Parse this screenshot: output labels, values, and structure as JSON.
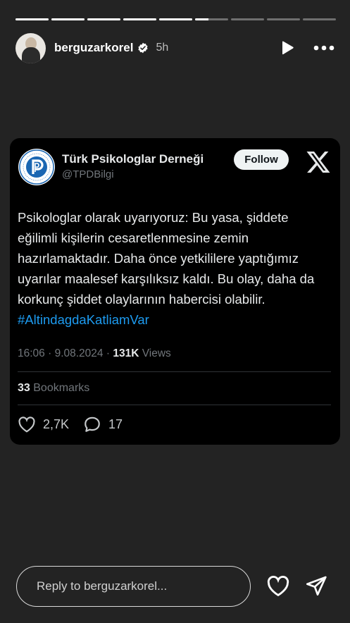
{
  "story": {
    "progress_segments": [
      1,
      1,
      1,
      1,
      1,
      0.4,
      0,
      0,
      0
    ]
  },
  "header": {
    "username": "berguzarkorel",
    "time": "5h",
    "verified": true
  },
  "tweet": {
    "author_name": "Türk Psikologlar Derneği",
    "author_handle": "@TPDBilgi",
    "follow_label": "Follow",
    "body_text": "Psikologlar olarak uyarıyoruz: Bu yasa, şiddete eğilimli kişilerin cesaretlenmesine zemin hazırlamaktadır. Daha önce yetkililere yaptığımız uyarılar maalesef karşılıksız kaldı. Bu olay, daha da korkunç şiddet olaylarının habercisi olabilir.",
    "hashtag": "#AltindagdaKatliamVar",
    "time": "16:06",
    "date": "9.08.2024",
    "views_count": "131K",
    "views_label": "Views",
    "bookmarks_count": "33",
    "bookmarks_label": "Bookmarks",
    "likes": "2,7K",
    "replies": "17"
  },
  "footer": {
    "reply_placeholder": "Reply to berguzarkorel..."
  },
  "colors": {
    "background": "#232323",
    "card": "#000000",
    "link": "#1d9bf0",
    "muted": "#71767b"
  }
}
